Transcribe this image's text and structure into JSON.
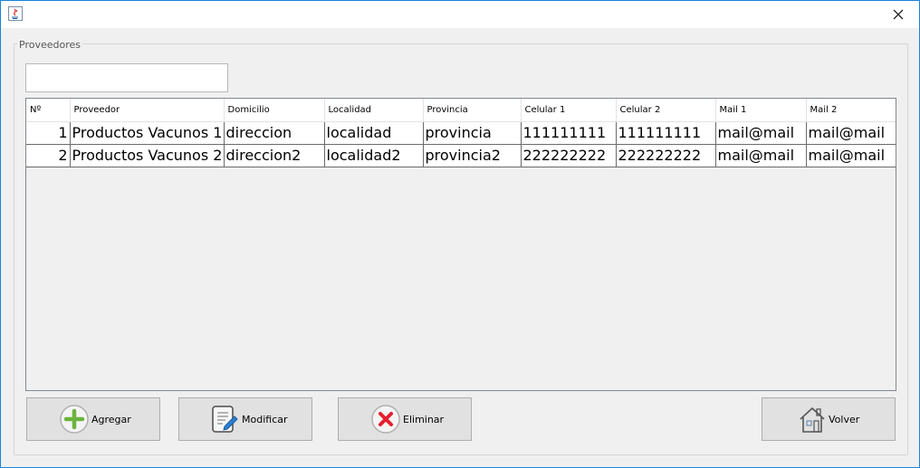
{
  "window": {
    "close_symbol": "✕"
  },
  "panel": {
    "title": "Proveedores"
  },
  "search": {
    "value": "",
    "placeholder": ""
  },
  "table": {
    "columns": [
      "Nº",
      "Proveedor",
      "Domicilio",
      "Localidad",
      "Provincia",
      "Celular 1",
      "Celular 2",
      "Mail 1",
      "Mail 2"
    ],
    "rows": [
      [
        "1",
        "Productos Vacunos 1",
        "direccion",
        "localidad",
        "provincia",
        "111111111",
        "111111111",
        "mail@mail",
        "mail@mail"
      ],
      [
        "2",
        "Productos Vacunos 2",
        "direccion2",
        "localidad2",
        "provincia2",
        "222222222",
        "222222222",
        "mail@mail",
        "mail@mail"
      ]
    ]
  },
  "buttons": {
    "agregar": "Agregar",
    "modificar": "Modificar",
    "eliminar": "Eliminar",
    "volver": "Volver"
  },
  "icons": {
    "app": "java-app-icon",
    "agregar": "plus-circle-icon",
    "modificar": "edit-document-icon",
    "eliminar": "delete-x-icon",
    "volver": "home-icon"
  },
  "colors": {
    "window_border": "#1883d7",
    "plus_green": "#6cb33e",
    "delete_red": "#e5202e",
    "edit_blue": "#2a7fd4"
  }
}
